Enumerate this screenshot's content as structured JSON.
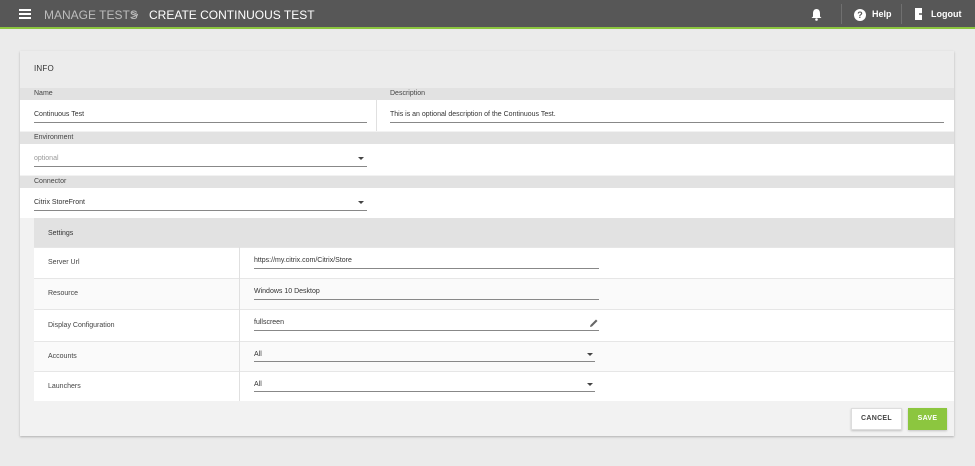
{
  "topbar": {
    "breadcrumb_parent": "MANAGE TESTS",
    "breadcrumb_separator": ">",
    "breadcrumb_current": "CREATE CONTINUOUS TEST",
    "help_label": "Help",
    "logout_label": "Logout",
    "accent_color": "#8cc63f",
    "bar_color": "#575757"
  },
  "info": {
    "section_title": "INFO",
    "name_label": "Name",
    "name_value": "Continuous Test",
    "description_label": "Description",
    "description_value": "This is an optional description of the Continuous Test.",
    "environment_label": "Environment",
    "environment_placeholder": "optional",
    "connector_label": "Connector",
    "connector_value": "Citrix StoreFront"
  },
  "settings": {
    "title": "Settings",
    "rows": [
      {
        "label": "Server Url",
        "value": "https://my.citrix.com/Citrix/Store"
      },
      {
        "label": "Resource",
        "value": "Windows 10 Desktop"
      },
      {
        "label": "Display Configuration",
        "value": "fullscreen",
        "icon": "pencil-icon"
      },
      {
        "label": "Accounts",
        "value": "All",
        "icon": "dropdown-caret"
      },
      {
        "label": "Launchers",
        "value": "All",
        "icon": "dropdown-caret"
      }
    ]
  },
  "actions": {
    "cancel_label": "CANCEL",
    "save_label": "SAVE"
  }
}
